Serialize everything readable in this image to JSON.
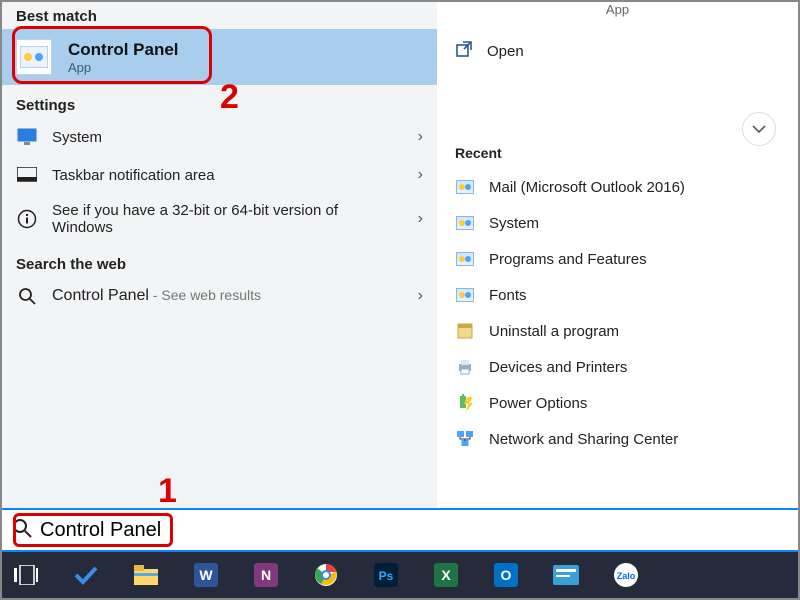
{
  "left": {
    "best_match_header": "Best match",
    "best_match": {
      "title": "Control Panel",
      "subtitle": "App"
    },
    "settings_header": "Settings",
    "settings": [
      {
        "label": "System"
      },
      {
        "label": "Taskbar notification area"
      },
      {
        "label": "See if you have a 32-bit or 64-bit version of Windows"
      }
    ],
    "web_header": "Search the web",
    "web": {
      "label": "Control Panel",
      "suffix": " - See web results"
    }
  },
  "right": {
    "top_label": "App",
    "open_label": "Open",
    "recent_header": "Recent",
    "recent": [
      "Mail (Microsoft Outlook 2016)",
      "System",
      "Programs and Features",
      "Fonts",
      "Uninstall a program",
      "Devices and Printers",
      "Power Options",
      "Network and Sharing Center"
    ]
  },
  "search": {
    "value": "Control Panel"
  },
  "annotations": {
    "n1": "1",
    "n2": "2"
  },
  "taskbar_icons": [
    "task-view",
    "todo",
    "file-explorer",
    "word",
    "onenote",
    "chrome",
    "photoshop",
    "excel",
    "outlook",
    "card",
    "zalo"
  ]
}
